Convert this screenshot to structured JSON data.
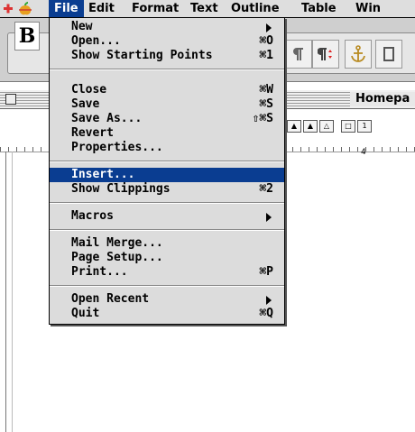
{
  "menubar": {
    "items": [
      "File",
      "Edit",
      "Format",
      "Text",
      "Outline",
      "Table",
      "Win"
    ]
  },
  "document": {
    "title": "Homepa",
    "ruler_label": "4"
  },
  "toolbar": {
    "bold_label": "B"
  },
  "file_menu": {
    "items": [
      {
        "label": "New",
        "shortcut": "",
        "submenu": true
      },
      {
        "label": "Open...",
        "shortcut": "⌘O"
      },
      {
        "label": "Show Starting Points",
        "shortcut": "⌘1"
      },
      {
        "label": "Close",
        "shortcut": "⌘W"
      },
      {
        "label": "Save",
        "shortcut": "⌘S"
      },
      {
        "label": "Save As...",
        "shortcut": "⇧⌘S"
      },
      {
        "label": "Revert",
        "shortcut": ""
      },
      {
        "label": "Properties...",
        "shortcut": ""
      },
      {
        "label": "Insert...",
        "shortcut": "",
        "highlighted": true
      },
      {
        "label": "Show Clippings",
        "shortcut": "⌘2"
      },
      {
        "label": "Macros",
        "shortcut": "",
        "submenu": true
      },
      {
        "label": "Mail Merge...",
        "shortcut": ""
      },
      {
        "label": "Page Setup...",
        "shortcut": ""
      },
      {
        "label": "Print...",
        "shortcut": "⌘P"
      },
      {
        "label": "Open Recent",
        "shortcut": "",
        "submenu": true
      },
      {
        "label": "Quit",
        "shortcut": "⌘Q"
      }
    ]
  },
  "colors": {
    "highlight": "#0a3d91",
    "menu_bg": "#dcdcdc"
  }
}
